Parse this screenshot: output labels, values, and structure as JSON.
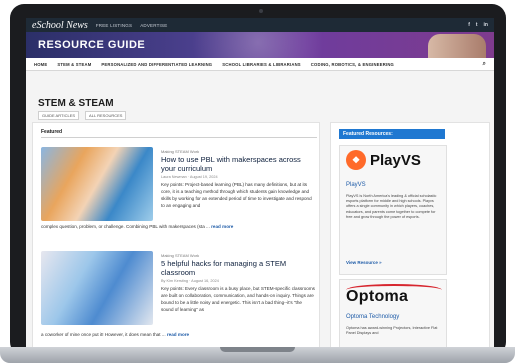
{
  "header": {
    "logo": "eSchool News",
    "top_links": [
      "FREE LISTINGS",
      "ADVERTISE"
    ],
    "social": [
      "f",
      "t",
      "in"
    ],
    "banner_title": "RESOURCE GUIDE"
  },
  "nav": {
    "items": [
      "HOME",
      "STEM & STEAM",
      "PERSONALIZED AND DIFFERENTIATED LEARNING",
      "SCHOOL LIBRARIES & LIBRARIANS",
      "CODING, ROBOTICS, & ENGINEERING"
    ],
    "search_icon": "search-icon"
  },
  "page": {
    "title": "STEM & STEAM",
    "subnav": [
      "GUIDE ARTICLES",
      "ALL RESOURCES"
    ]
  },
  "featured": {
    "label": "Featured",
    "articles": [
      {
        "category": "Making STEAM Work",
        "title": "How to use PBL with makerspaces across your curriculum",
        "meta": "Laura Newman · August 19, 2024",
        "body": "Key points: Project-based learning (PBL) has many definitions, but at its core, it is a teaching method through which students gain knowledge and skills by working for an extended period of time to investigate and respond to an engaging and",
        "body_cont": "complex question, problem, or challenge. Combining PBL with makerspaces (sta ...",
        "more": "read more"
      },
      {
        "category": "Making STEAM Work",
        "title": "5 helpful hacks for managing a STEM classroom",
        "meta": "By Kim Kersting · August 16, 2024",
        "body": "Key points: Every classroom is a busy place, but STEM-specific classrooms are built on collaboration, communication, and hands-on inquiry. Things are bound to be a little noisy and energetic. This isn't a bad thing--it's \"the sound of learning\" as",
        "body_cont": "a coworker of mine once put it! However, it does mean that ...",
        "more": "read more"
      }
    ]
  },
  "sidebar": {
    "heading": "Featured Resources:",
    "resources": [
      {
        "logo_text": "PlayVS",
        "name": "PlayVS",
        "desc": "PlayVS is North America's leading & official scholastic esports platform for middle and high schools. Playvs offers a single community in which players, coaches, educators, and parents come together to compete for free and grow through the power of esports.",
        "link": "View Resource »"
      },
      {
        "logo_text": "Optoma",
        "name": "Optoma Technology",
        "desc": "Optoma has award-winning Projectors, Interactive Flat Panel Displays and"
      }
    ]
  },
  "colors": {
    "accent": "#1f78d1",
    "title_blue": "#0d1f3c",
    "playvs_orange": "#ff6a2a",
    "optoma_red": "#d7262f"
  }
}
